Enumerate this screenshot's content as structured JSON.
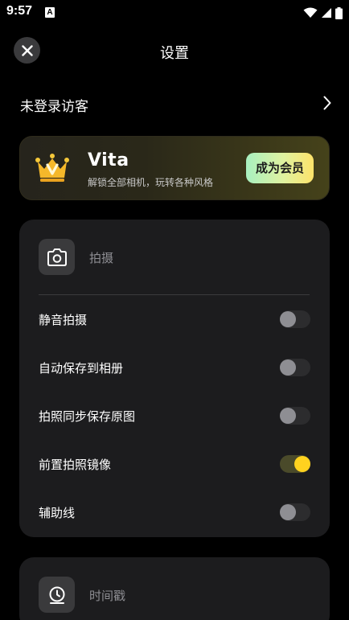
{
  "status_bar": {
    "time": "9:57",
    "app_icon_letter": "A",
    "icons": [
      "wifi-icon",
      "signal-icon",
      "battery-icon"
    ]
  },
  "header": {
    "title": "设置",
    "close_icon": "close-icon"
  },
  "account": {
    "label": "未登录访客",
    "chevron_icon": "chevron-right-icon"
  },
  "vip": {
    "title": "Vita",
    "subtitle": "解锁全部相机，玩转各种风格",
    "button_label": "成为会员",
    "crown_icon": "crown-icon",
    "accent_color": "#ffd21f"
  },
  "shoot_section": {
    "icon": "camera-icon",
    "title": "拍摄",
    "settings": [
      {
        "label": "静音拍摄",
        "on": false
      },
      {
        "label": "自动保存到相册",
        "on": false
      },
      {
        "label": "拍照同步保存原图",
        "on": false
      },
      {
        "label": "前置拍照镜像",
        "on": true
      },
      {
        "label": "辅助线",
        "on": false
      }
    ]
  },
  "timestamp_section": {
    "icon": "clock-icon",
    "title": "时间戳"
  },
  "colors": {
    "background": "#000000",
    "card": "#1c1c1e",
    "toggle_on_knob": "#ffd21f",
    "toggle_off_knob": "#8e8e93"
  }
}
